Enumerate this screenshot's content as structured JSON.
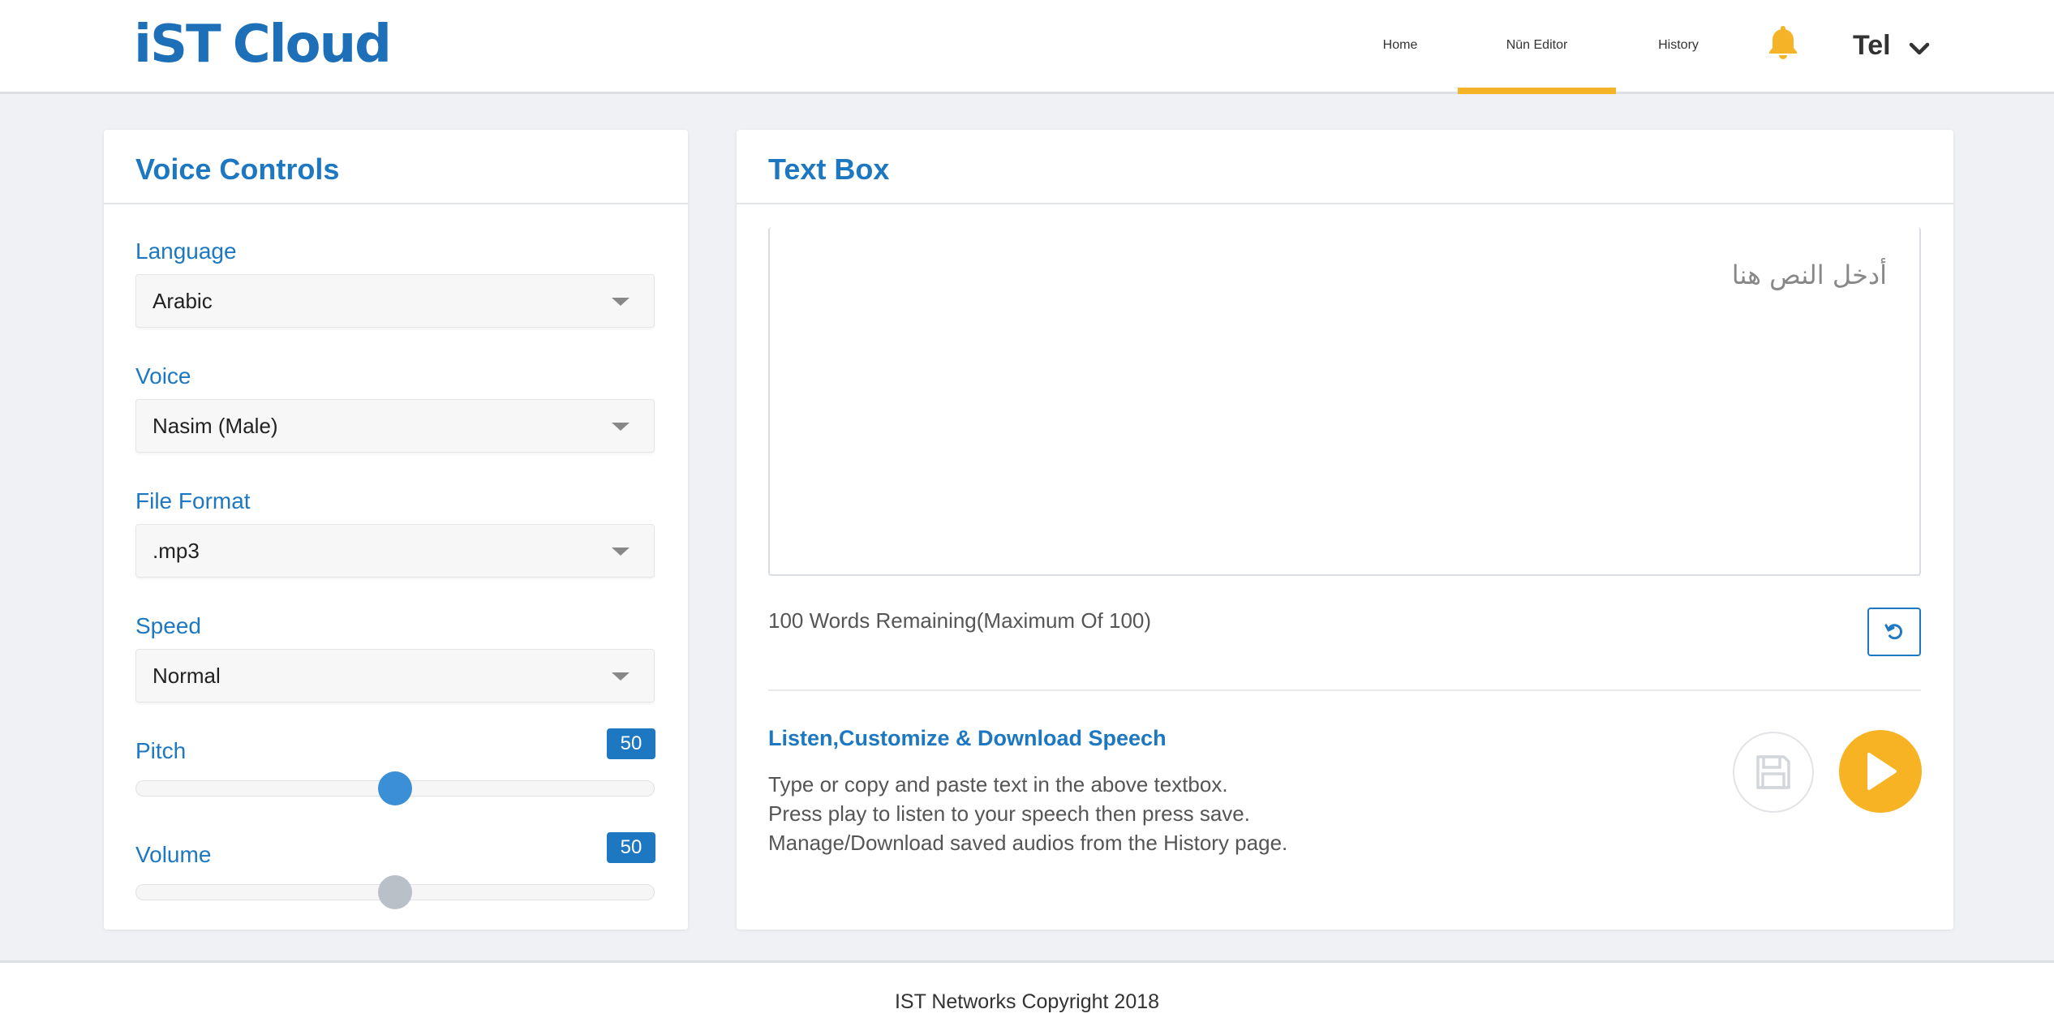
{
  "header": {
    "logo_ist": "iST",
    "logo_cloud": "Cloud",
    "nav": [
      {
        "label": "Home"
      },
      {
        "label": "Nūn Editor"
      },
      {
        "label": "History"
      }
    ],
    "user_label": "Tel"
  },
  "voice_controls": {
    "title": "Voice Controls",
    "language": {
      "label": "Language",
      "value": "Arabic"
    },
    "voice": {
      "label": "Voice",
      "value": "Nasim (Male)"
    },
    "file_format": {
      "label": "File Format",
      "value": ".mp3"
    },
    "speed": {
      "label": "Speed",
      "value": "Normal"
    },
    "pitch": {
      "label": "Pitch",
      "value": "50",
      "level": 0.5
    },
    "volume": {
      "label": "Volume",
      "value": "50",
      "level": 0.5
    }
  },
  "text_box": {
    "title": "Text Box",
    "placeholder": "أدخل النص هنا",
    "remaining": "100 Words Remaining(Maximum Of 100)",
    "listen_title": "Listen,Customize & Download Speech",
    "instructions": [
      "Type or copy and paste text in the above textbox.",
      "Press play to listen to your speech then press save.",
      "Manage/Download saved audios from the History page."
    ]
  },
  "footer": {
    "copyright": "IST Networks Copyright 2018"
  },
  "colors": {
    "accent_blue": "#1d78c1",
    "accent_orange": "#f8b324"
  }
}
